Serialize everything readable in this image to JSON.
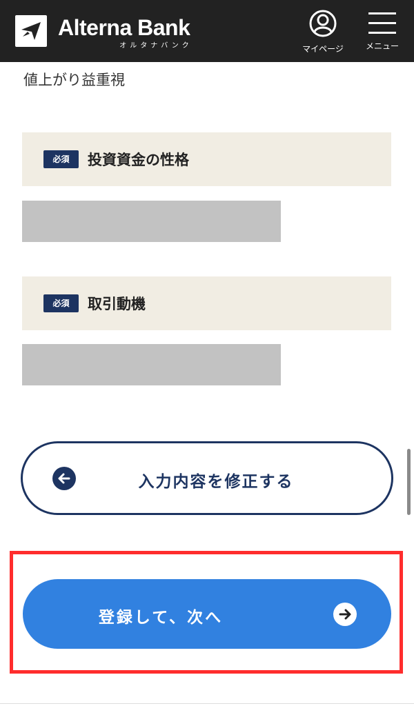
{
  "header": {
    "brand_name": "Alterna Bank",
    "brand_sub": "オルタナバンク",
    "mypage_label": "マイページ",
    "menu_label": "メニュー",
    "icons": [
      "logo-icon",
      "user-icon",
      "menu-icon"
    ]
  },
  "form": {
    "previous_value": "値上がり益重視",
    "questions": [
      {
        "required_badge": "必須",
        "label": "投資資金の性格"
      },
      {
        "required_badge": "必須",
        "label": "取引動機"
      }
    ]
  },
  "actions": {
    "back_label": "入力内容を修正する",
    "back_icon": "arrow-left-icon",
    "next_label": "登録して、次へ",
    "next_icon": "arrow-right-icon"
  },
  "colors": {
    "header_bg": "#222222",
    "navy": "#1d3461",
    "primary_blue": "#3181e0",
    "question_bg": "#f1ede3",
    "redacted": "#c2c2c2",
    "highlight": "#ff2d2d"
  }
}
